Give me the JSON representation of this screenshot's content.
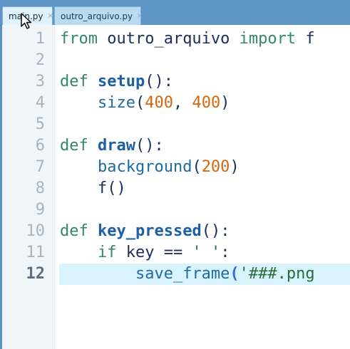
{
  "tabs": [
    {
      "label": "main.py",
      "close": "×",
      "active": true
    },
    {
      "label": "outro_arquivo.py",
      "close": "×",
      "active": false
    }
  ],
  "editor": {
    "current_line": 12,
    "lines": [
      {
        "n": "1",
        "tokens": [
          [
            "kw",
            "from"
          ],
          [
            "plain",
            " outro_arquivo "
          ],
          [
            "kw",
            "import"
          ],
          [
            "plain",
            " f"
          ]
        ]
      },
      {
        "n": "2",
        "tokens": []
      },
      {
        "n": "3",
        "tokens": [
          [
            "kw",
            "def"
          ],
          [
            "plain",
            " "
          ],
          [
            "fn",
            "setup"
          ],
          [
            "plain",
            "():"
          ]
        ]
      },
      {
        "n": "4",
        "tokens": [
          [
            "plain",
            "    "
          ],
          [
            "call",
            "size"
          ],
          [
            "plain",
            "("
          ],
          [
            "num",
            "400"
          ],
          [
            "plain",
            ", "
          ],
          [
            "num",
            "400"
          ],
          [
            "plain",
            ")"
          ]
        ]
      },
      {
        "n": "5",
        "tokens": []
      },
      {
        "n": "6",
        "tokens": [
          [
            "kw",
            "def"
          ],
          [
            "plain",
            " "
          ],
          [
            "fn",
            "draw"
          ],
          [
            "plain",
            "():"
          ]
        ]
      },
      {
        "n": "7",
        "tokens": [
          [
            "plain",
            "    "
          ],
          [
            "call",
            "background"
          ],
          [
            "plain",
            "("
          ],
          [
            "num",
            "200"
          ],
          [
            "plain",
            ")"
          ]
        ]
      },
      {
        "n": "8",
        "tokens": [
          [
            "plain",
            "    "
          ],
          [
            "plain",
            "f()"
          ]
        ]
      },
      {
        "n": "9",
        "tokens": []
      },
      {
        "n": "10",
        "tokens": [
          [
            "kw",
            "def"
          ],
          [
            "plain",
            " "
          ],
          [
            "fn",
            "key_pressed"
          ],
          [
            "plain",
            "():"
          ]
        ]
      },
      {
        "n": "11",
        "tokens": [
          [
            "plain",
            "    "
          ],
          [
            "kw",
            "if"
          ],
          [
            "plain",
            " key == "
          ],
          [
            "str",
            "' '"
          ],
          [
            "plain",
            ":"
          ]
        ]
      },
      {
        "n": "12",
        "tokens": [
          [
            "plain",
            "        "
          ],
          [
            "call",
            "save_frame"
          ],
          [
            "bracket-hl",
            "("
          ],
          [
            "str",
            "'###.png"
          ]
        ]
      }
    ]
  },
  "cursor": {
    "icon": "mouse-pointer-icon"
  }
}
